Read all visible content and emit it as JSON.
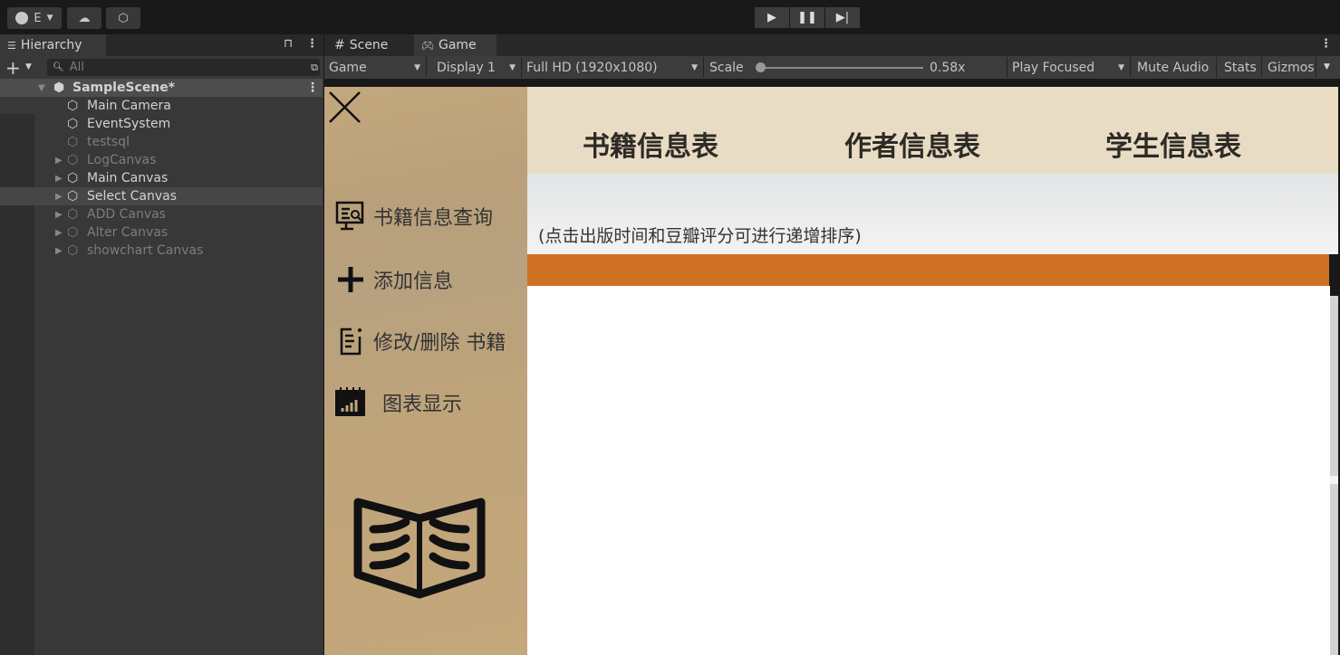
{
  "toolbar": {
    "account_label": "E",
    "play_icon": "play",
    "pause_icon": "pause",
    "step_icon": "step"
  },
  "hierarchy": {
    "title": "Hierarchy",
    "search_placeholder": "All",
    "scene": "SampleScene*",
    "items": [
      {
        "label": "Main Camera",
        "active": true,
        "expandable": false
      },
      {
        "label": "EventSystem",
        "active": true,
        "expandable": false
      },
      {
        "label": "testsql",
        "active": false,
        "expandable": false
      },
      {
        "label": "LogCanvas",
        "active": false,
        "expandable": true
      },
      {
        "label": "Main Canvas",
        "active": true,
        "expandable": true
      },
      {
        "label": "Select Canvas",
        "active": true,
        "expandable": true,
        "selected": true
      },
      {
        "label": "ADD Canvas",
        "active": false,
        "expandable": true
      },
      {
        "label": "Alter Canvas",
        "active": false,
        "expandable": true
      },
      {
        "label": "showchart Canvas",
        "active": false,
        "expandable": true
      }
    ]
  },
  "view_tabs": {
    "scene": "Scene",
    "game": "Game"
  },
  "game_toolbar": {
    "mode": "Game",
    "display": "Display 1",
    "resolution": "Full HD (1920x1080)",
    "scale_label": "Scale",
    "scale_value": "0.58x",
    "play_focused": "Play Focused",
    "mute": "Mute Audio",
    "stats": "Stats",
    "gizmos": "Gizmos"
  },
  "app": {
    "menu": [
      {
        "label": "书籍信息查询",
        "icon": "search-monitor-icon"
      },
      {
        "label": "添加信息",
        "icon": "plus-icon"
      },
      {
        "label": "修改/删除 书籍",
        "icon": "clipboard-icon"
      },
      {
        "label": "图表显示",
        "icon": "chart-calendar-icon"
      }
    ],
    "tabs": [
      "书籍信息表",
      "作者信息表",
      "学生信息表"
    ],
    "hint": "(点击出版时间和豆瓣评分可进行递增排序)",
    "accent": "#cf7124"
  }
}
